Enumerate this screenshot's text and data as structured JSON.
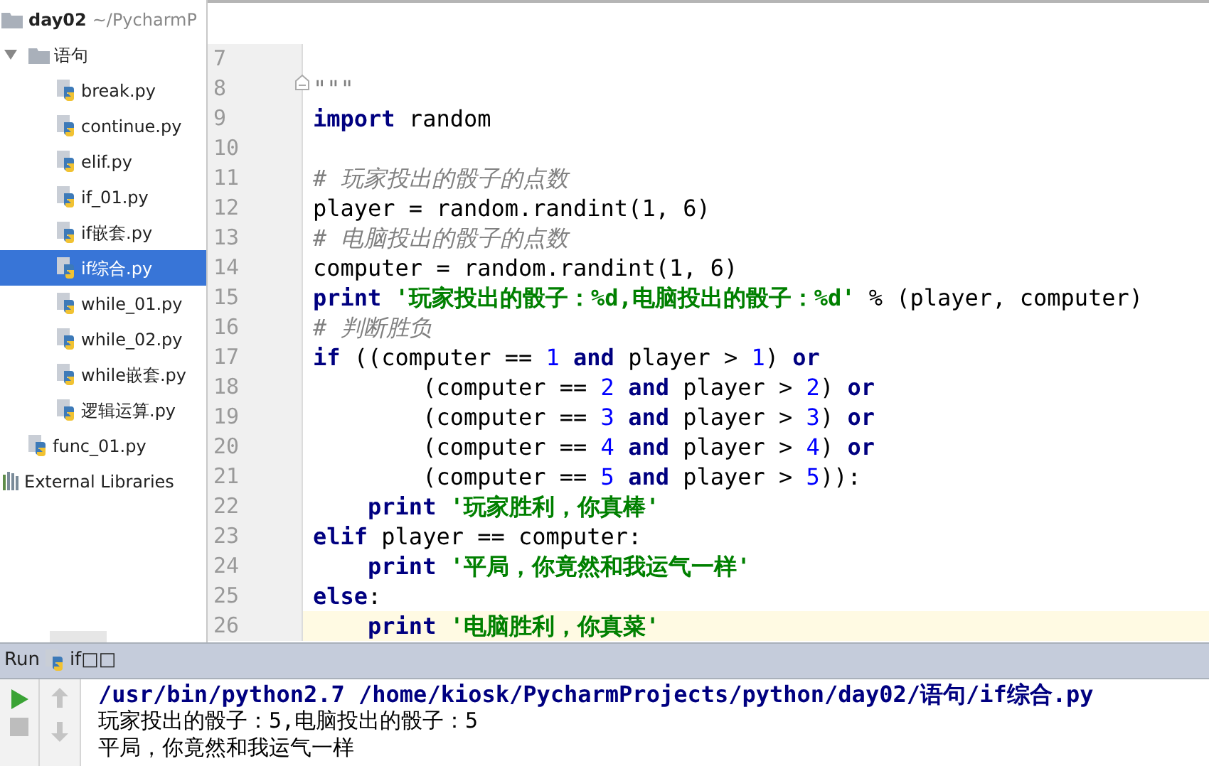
{
  "project": {
    "name": "day02",
    "path": "~/PycharmP",
    "items": [
      {
        "kind": "folder",
        "name": "语句",
        "expanded": true,
        "selected": false,
        "children": [
          {
            "kind": "file",
            "name": "break.py",
            "selected": false
          },
          {
            "kind": "file",
            "name": "continue.py",
            "selected": false
          },
          {
            "kind": "file",
            "name": "elif.py",
            "selected": false
          },
          {
            "kind": "file",
            "name": "if_01.py",
            "selected": false
          },
          {
            "kind": "file",
            "name": "if嵌套.py",
            "selected": false
          },
          {
            "kind": "file",
            "name": "if综合.py",
            "selected": true
          },
          {
            "kind": "file",
            "name": "while_01.py",
            "selected": false
          },
          {
            "kind": "file",
            "name": "while_02.py",
            "selected": false
          },
          {
            "kind": "file",
            "name": "while嵌套.py",
            "selected": false
          },
          {
            "kind": "file",
            "name": "逻辑运算.py",
            "selected": false
          }
        ]
      },
      {
        "kind": "file",
        "name": "func_01.py",
        "selected": false
      },
      {
        "kind": "library",
        "name": "External Libraries",
        "selected": false
      }
    ]
  },
  "editor": {
    "lines": [
      {
        "number": "7",
        "current": false,
        "fold_marker": false
      },
      {
        "number": "8",
        "current": false,
        "fold_marker": true,
        "tokens": [
          {
            "kind": "doc",
            "text": "\"\"\""
          }
        ]
      },
      {
        "number": "9",
        "current": false,
        "fold_marker": false,
        "tokens": [
          {
            "kind": "keyword",
            "text": "import"
          },
          {
            "kind": "plain",
            "text": " random"
          }
        ]
      },
      {
        "number": "10",
        "current": false,
        "fold_marker": false
      },
      {
        "number": "11",
        "current": false,
        "fold_marker": false,
        "tokens": [
          {
            "kind": "comment",
            "text": "# 玩家投出的骰子的点数"
          }
        ]
      },
      {
        "number": "12",
        "current": false,
        "fold_marker": false,
        "tokens": [
          {
            "kind": "plain",
            "text": "player = random.randint(1, 6)"
          }
        ]
      },
      {
        "number": "13",
        "current": false,
        "fold_marker": false,
        "tokens": [
          {
            "kind": "comment",
            "text": "# 电脑投出的骰子的点数"
          }
        ]
      },
      {
        "number": "14",
        "current": false,
        "fold_marker": false,
        "tokens": [
          {
            "kind": "plain",
            "text": "computer = random.randint(1, 6)"
          }
        ]
      },
      {
        "number": "15",
        "current": false,
        "fold_marker": false,
        "tokens": [
          {
            "kind": "keyword",
            "text": "print"
          },
          {
            "kind": "string",
            "text": " '玩家投出的骰子：%d,电脑投出的骰子：%d'"
          },
          {
            "kind": "plain",
            "text": " % (player, computer)"
          }
        ]
      },
      {
        "number": "16",
        "current": false,
        "fold_marker": false,
        "tokens": [
          {
            "kind": "comment",
            "text": "# 判断胜负"
          }
        ]
      },
      {
        "number": "17",
        "current": false,
        "fold_marker": false,
        "tokens": [
          {
            "kind": "keyword",
            "text": "if"
          },
          {
            "kind": "plain",
            "text": " ((computer == "
          },
          {
            "kind": "number",
            "text": "1"
          },
          {
            "kind": "keyword",
            "text": " and"
          },
          {
            "kind": "plain",
            "text": " player > "
          },
          {
            "kind": "number",
            "text": "1"
          },
          {
            "kind": "plain",
            "text": ") "
          },
          {
            "kind": "keyword",
            "text": "or"
          }
        ]
      },
      {
        "number": "18",
        "current": false,
        "fold_marker": false,
        "tokens": [
          {
            "kind": "plain",
            "text": "        (computer == "
          },
          {
            "kind": "number",
            "text": "2"
          },
          {
            "kind": "keyword",
            "text": " and"
          },
          {
            "kind": "plain",
            "text": " player > "
          },
          {
            "kind": "number",
            "text": "2"
          },
          {
            "kind": "plain",
            "text": ") "
          },
          {
            "kind": "keyword",
            "text": "or"
          }
        ]
      },
      {
        "number": "19",
        "current": false,
        "fold_marker": false,
        "tokens": [
          {
            "kind": "plain",
            "text": "        (computer == "
          },
          {
            "kind": "number",
            "text": "3"
          },
          {
            "kind": "keyword",
            "text": " and"
          },
          {
            "kind": "plain",
            "text": " player > "
          },
          {
            "kind": "number",
            "text": "3"
          },
          {
            "kind": "plain",
            "text": ") "
          },
          {
            "kind": "keyword",
            "text": "or"
          }
        ]
      },
      {
        "number": "20",
        "current": false,
        "fold_marker": false,
        "tokens": [
          {
            "kind": "plain",
            "text": "        (computer == "
          },
          {
            "kind": "number",
            "text": "4"
          },
          {
            "kind": "keyword",
            "text": " and"
          },
          {
            "kind": "plain",
            "text": " player > "
          },
          {
            "kind": "number",
            "text": "4"
          },
          {
            "kind": "plain",
            "text": ") "
          },
          {
            "kind": "keyword",
            "text": "or"
          }
        ]
      },
      {
        "number": "21",
        "current": false,
        "fold_marker": false,
        "tokens": [
          {
            "kind": "plain",
            "text": "        (computer == "
          },
          {
            "kind": "number",
            "text": "5"
          },
          {
            "kind": "keyword",
            "text": " and"
          },
          {
            "kind": "plain",
            "text": " player > "
          },
          {
            "kind": "number",
            "text": "5"
          },
          {
            "kind": "plain",
            "text": ")):"
          }
        ]
      },
      {
        "number": "22",
        "current": false,
        "fold_marker": false,
        "tokens": [
          {
            "kind": "keyword",
            "text": "    print"
          },
          {
            "kind": "string",
            "text": " '玩家胜利，你真棒'"
          }
        ]
      },
      {
        "number": "23",
        "current": false,
        "fold_marker": false,
        "tokens": [
          {
            "kind": "keyword",
            "text": "elif"
          },
          {
            "kind": "plain",
            "text": " player == computer:"
          }
        ]
      },
      {
        "number": "24",
        "current": false,
        "fold_marker": false,
        "tokens": [
          {
            "kind": "keyword",
            "text": "    print"
          },
          {
            "kind": "string",
            "text": " '平局，你竟然和我运气一样'"
          }
        ]
      },
      {
        "number": "25",
        "current": false,
        "fold_marker": false,
        "tokens": [
          {
            "kind": "keyword",
            "text": "else"
          },
          {
            "kind": "plain",
            "text": ":"
          }
        ]
      },
      {
        "number": "26",
        "current": true,
        "fold_marker": false,
        "tokens": [
          {
            "kind": "keyword",
            "text": "    print"
          },
          {
            "kind": "string",
            "text": " '电脑胜利，你真菜'"
          }
        ]
      }
    ]
  },
  "run_panel": {
    "title": "Run",
    "tab": "if□□",
    "console": [
      {
        "kind": "command",
        "text": "/usr/bin/python2.7 /home/kiosk/PycharmProjects/python/day02/语句/if综合.py"
      },
      {
        "kind": "output",
        "text": "玩家投出的骰子：5,电脑投出的骰子：5"
      },
      {
        "kind": "output",
        "text": "平局，你竟然和我运气一样"
      }
    ]
  }
}
